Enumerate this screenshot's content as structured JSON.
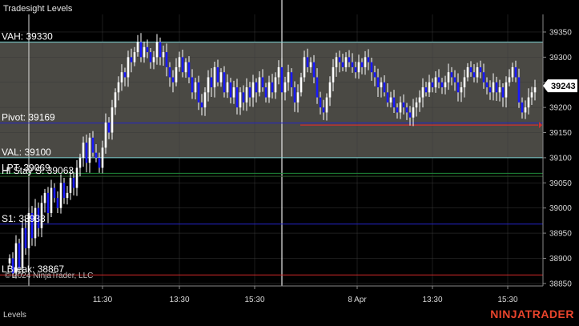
{
  "window": {
    "title": "Tradesight Levels",
    "panel_label": "Levels",
    "brand": "NINJATRADER",
    "copyright": "© 2024 NinjaTrader, LLC"
  },
  "colors": {
    "background": "#000000",
    "band": "#4a4944",
    "up_candle": "#ffffff",
    "down_candle": "#1a1aff",
    "vah_line": "#7fd6d6",
    "val_line": "#7fd6d6",
    "pivot_line": "#2424c8",
    "s1_line": "#2424c8",
    "lbreak_line": "#d02828",
    "lpt_line": "#1f8a3a",
    "grid": "#3a3a3a",
    "price_marker": "#d03030"
  },
  "chart_data": {
    "type": "candlestick",
    "y_ticks": [
      39350,
      39300,
      39250,
      39200,
      39150,
      39100,
      39050,
      39000,
      38950,
      38900,
      38850
    ],
    "ylim": [
      38845,
      39385
    ],
    "x_ticks": [
      "11:30",
      "13:30",
      "15:30",
      "8 Apr",
      "13:30",
      "15:30"
    ],
    "current_price": "39243",
    "levels": [
      {
        "name": "VAH",
        "label": "VAH: 39330",
        "value": 39330,
        "color": "#7fd6d6"
      },
      {
        "name": "Pivot",
        "label": "Pivot: 39169",
        "value": 39169,
        "color": "#2424c8"
      },
      {
        "name": "VAL",
        "label": "VAL: 39100",
        "value": 39100,
        "color": "#7fd6d6"
      },
      {
        "name": "LPT",
        "label": "LPT: 39069",
        "value": 39069,
        "color": "#1f8a3a"
      },
      {
        "name": "HiStay",
        "label": "Hi Stay S: 39063",
        "value": 39063,
        "color": "#2a5a2a"
      },
      {
        "name": "S1",
        "label": "S1: 38938",
        "value": 38968,
        "color": "#2424c8"
      },
      {
        "name": "LBreak",
        "label": "LBreak: 38867",
        "value": 38867,
        "color": "#d02828"
      }
    ],
    "value_area": [
      39100,
      39330
    ],
    "red_marker_level": 39165,
    "closes": [
      38900,
      38870,
      38930,
      38880,
      38960,
      38920,
      38990,
      38940,
      39000,
      38960,
      39010,
      39030,
      38990,
      39040,
      39020,
      39000,
      39050,
      39020,
      39030,
      39060,
      39040,
      39080,
      39100,
      39130,
      39090,
      39140,
      39110,
      39100,
      39080,
      39120,
      39170,
      39150,
      39200,
      39230,
      39250,
      39270,
      39260,
      39300,
      39290,
      39310,
      39330,
      39300,
      39320,
      39310,
      39290,
      39300,
      39330,
      39300,
      39310,
      39280,
      39260,
      39250,
      39280,
      39300,
      39270,
      39290,
      39260,
      39230,
      39250,
      39210,
      39200,
      39230,
      39260,
      39240,
      39280,
      39250,
      39270,
      39230,
      39250,
      39220,
      39240,
      39200,
      39230,
      39210,
      39240,
      39220,
      39250,
      39230,
      39260,
      39240,
      39220,
      39250,
      39230,
      39260,
      39280,
      39230,
      39250,
      39270,
      39240,
      39210,
      39230,
      39260,
      39300,
      39280,
      39290,
      39260,
      39220,
      39200,
      39190,
      39220,
      39250,
      39280,
      39300,
      39290,
      39280,
      39300,
      39290,
      39280,
      39270,
      39290,
      39280,
      39300,
      39290,
      39270,
      39260,
      39240,
      39250,
      39230,
      39210,
      39220,
      39200,
      39190,
      39210,
      39200,
      39190,
      39180,
      39200,
      39210,
      39220,
      39240,
      39230,
      39250,
      39240,
      39260,
      39250,
      39240,
      39250,
      39270,
      39260,
      39250,
      39230,
      39240,
      39260,
      39280,
      39270,
      39260,
      39280,
      39270,
      39250,
      39240,
      39230,
      39250,
      39230,
      39240,
      39220,
      39250,
      39260,
      39280,
      39260,
      39210,
      39190,
      39200,
      39220,
      39230,
      39240
    ],
    "candle_count": 170
  }
}
